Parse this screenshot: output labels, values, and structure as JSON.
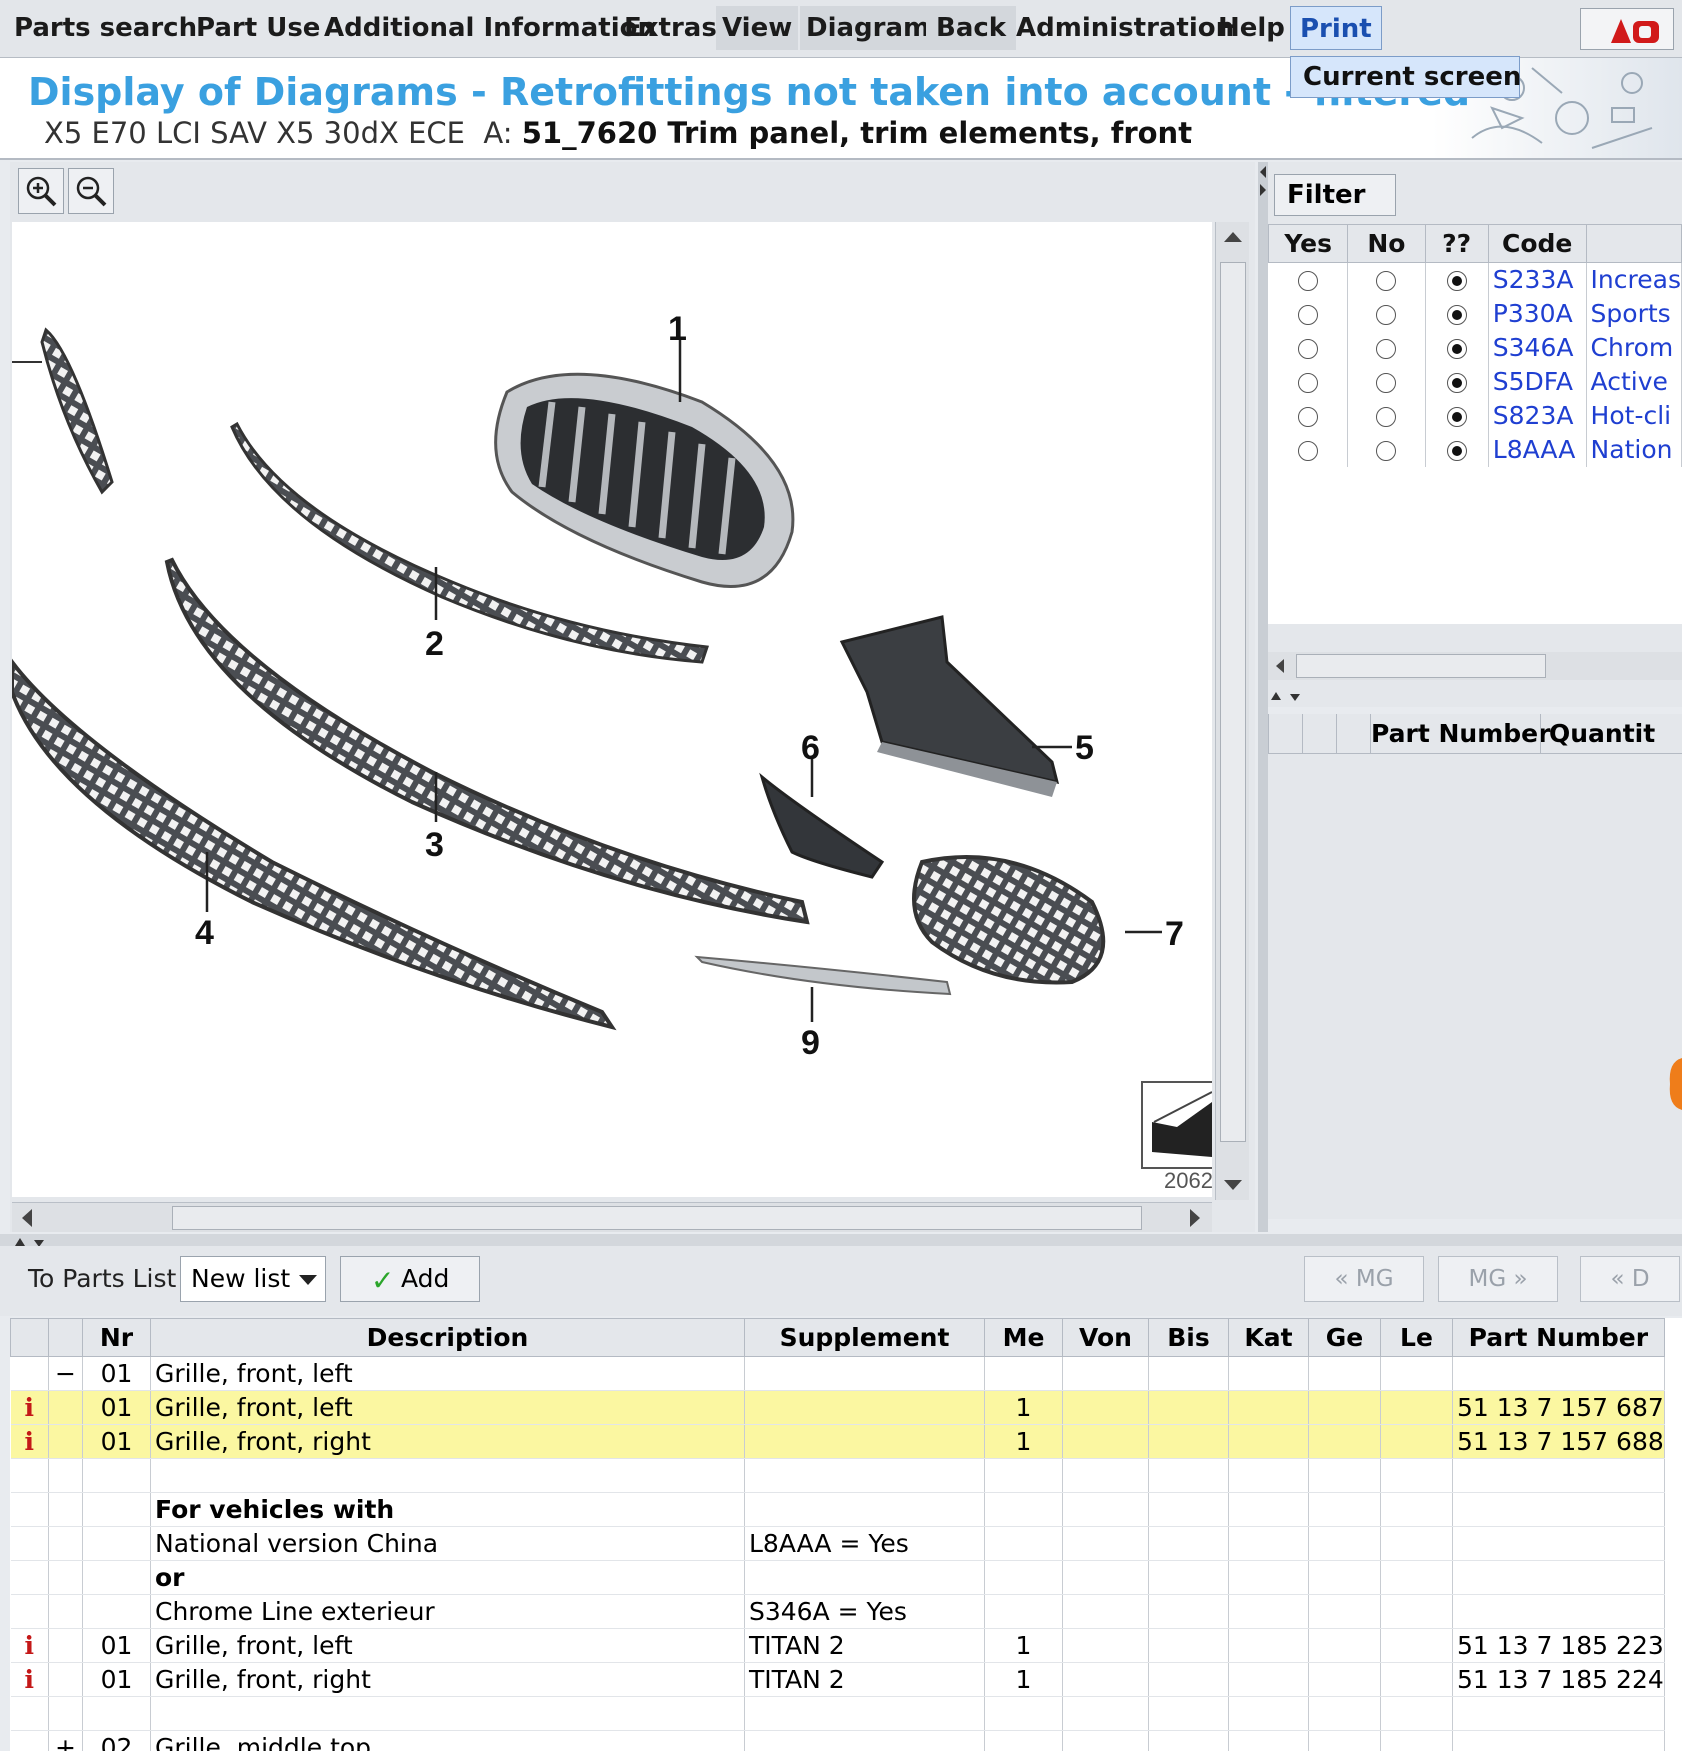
{
  "menu": {
    "items": [
      "Parts search",
      "Part Use",
      "Additional Information",
      "Extras",
      "View",
      "Diagram",
      "Back",
      "Administration",
      "Help",
      "Print"
    ],
    "print_dropdown": "Current screen"
  },
  "header": {
    "title": "Display of Diagrams - Retrofittings not taken into account - filtered",
    "vehicle": "X5 E70 LCI SAV X5 30dX ECE",
    "assembly_prefix": "A:",
    "assembly": "51_7620 Trim panel, trim elements, front"
  },
  "diagram": {
    "callouts": [
      "1",
      "2",
      "3",
      "4",
      "5",
      "6",
      "7",
      "9"
    ],
    "image_number": "2062"
  },
  "filter": {
    "button": "Filter",
    "columns": [
      "Yes",
      "No",
      "??",
      "Code"
    ],
    "rows": [
      {
        "code": "S233A",
        "desc": "Increas",
        "selected": "??"
      },
      {
        "code": "P330A",
        "desc": "Sports",
        "selected": "??"
      },
      {
        "code": "S346A",
        "desc": "Chrom",
        "selected": "??"
      },
      {
        "code": "S5DFA",
        "desc": "Active",
        "selected": "??"
      },
      {
        "code": "S823A",
        "desc": "Hot-cli",
        "selected": "??"
      },
      {
        "code": "L8AAA",
        "desc": "Nation",
        "selected": "??"
      }
    ]
  },
  "part_numbers_pane": {
    "columns": [
      "Part Number",
      "Quantit"
    ]
  },
  "toolbar": {
    "to_parts_list": "To Parts List",
    "list_select": "New list",
    "add": "Add",
    "prev_mg": "« MG",
    "next_mg": "MG »",
    "prev_d": "« D"
  },
  "parts": {
    "columns": [
      "Nr",
      "Description",
      "Supplement",
      "Me",
      "Von",
      "Bis",
      "Kat",
      "Ge",
      "Le",
      "Part Number"
    ],
    "rows": [
      {
        "info": "",
        "expand": "−",
        "nr": "01",
        "desc": "Grille, front, left",
        "supp": "",
        "me": "",
        "pn": "",
        "style": "group"
      },
      {
        "info": "i",
        "expand": "",
        "nr": "01",
        "desc": "Grille, front, left",
        "supp": "",
        "me": "1",
        "pn": "51 13 7 157 687",
        "style": "yellow"
      },
      {
        "info": "i",
        "expand": "",
        "nr": "01",
        "desc": "Grille, front, right",
        "supp": "",
        "me": "1",
        "pn": "51 13 7 157 688",
        "style": "yellow"
      },
      {
        "info": "",
        "expand": "",
        "nr": "",
        "desc": "",
        "supp": "",
        "me": "",
        "pn": "",
        "style": ""
      },
      {
        "info": "",
        "expand": "",
        "nr": "",
        "desc": "For vehicles with",
        "supp": "",
        "me": "",
        "pn": "",
        "style": "bold"
      },
      {
        "info": "",
        "expand": "",
        "nr": "",
        "desc": "National version China",
        "supp": "L8AAA = Yes",
        "me": "",
        "pn": "",
        "style": ""
      },
      {
        "info": "",
        "expand": "",
        "nr": "",
        "desc": "or",
        "supp": "",
        "me": "",
        "pn": "",
        "style": "bold"
      },
      {
        "info": "",
        "expand": "",
        "nr": "",
        "desc": "Chrome Line exterieur",
        "supp": "S346A = Yes",
        "me": "",
        "pn": "",
        "style": ""
      },
      {
        "info": "i",
        "expand": "",
        "nr": "01",
        "desc": "Grille, front, left",
        "supp": "TITAN 2",
        "me": "1",
        "pn": "51 13 7 185 223",
        "style": ""
      },
      {
        "info": "i",
        "expand": "",
        "nr": "01",
        "desc": "Grille, front, right",
        "supp": "TITAN 2",
        "me": "1",
        "pn": "51 13 7 185 224",
        "style": ""
      },
      {
        "info": "",
        "expand": "",
        "nr": "",
        "desc": "",
        "supp": "",
        "me": "",
        "pn": "",
        "style": ""
      },
      {
        "info": "",
        "expand": "+",
        "nr": "02",
        "desc": "Grille, middle top",
        "supp": "",
        "me": "",
        "pn": "",
        "style": "group"
      }
    ]
  },
  "colors": {
    "title": "#3aa0e0",
    "code_link": "#1f3fd1",
    "highlight_row": "#fbf7a1",
    "info_icon": "#c41818"
  }
}
